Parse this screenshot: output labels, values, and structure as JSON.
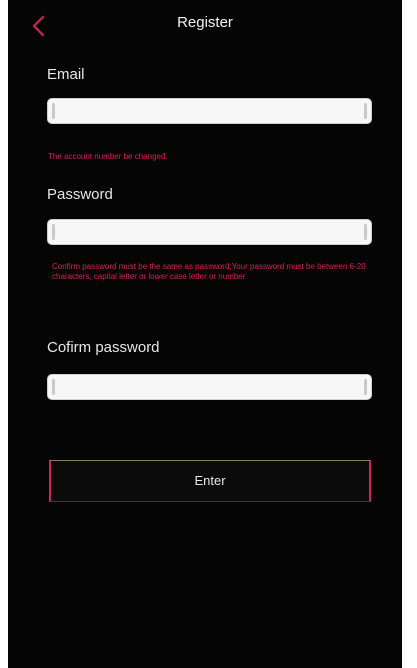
{
  "header": {
    "title": "Register",
    "back_icon": "chevron-left-icon"
  },
  "form": {
    "email": {
      "label": "Email",
      "value": "",
      "error": "The account number be changed."
    },
    "password": {
      "label": "Password",
      "value": "",
      "error": "Confirm password must be the same as password;Your password must be between 6-20 characters, capital letter or lower case letter or number"
    },
    "confirm": {
      "label": "Cofirm password",
      "value": ""
    },
    "enter_label": "Enter"
  },
  "colors": {
    "background": "#050505",
    "accent": "#d0265a",
    "error": "#d8214f",
    "field": "#f7f7f7"
  }
}
